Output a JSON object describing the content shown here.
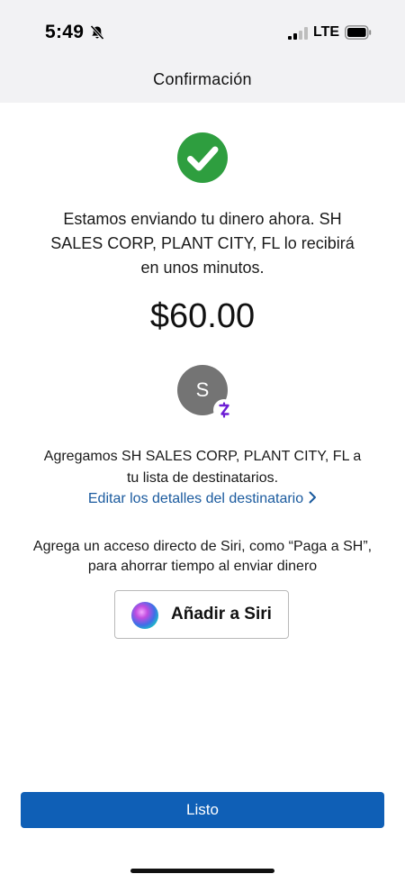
{
  "status_bar": {
    "time": "5:49",
    "network": "LTE",
    "icons": [
      "bell-slash-icon",
      "signal-icon",
      "battery-icon"
    ]
  },
  "header": {
    "title": "Confirmación"
  },
  "confirmation": {
    "message": "Estamos enviando tu dinero ahora. SH SALES CORP, PLANT CITY, FL lo recibirá en unos minutos.",
    "amount": "$60.00",
    "icon": "check-circle-icon",
    "accent_color": "#2e9e3f"
  },
  "recipient": {
    "avatar_initial": "S",
    "avatar_color": "#747474",
    "badge_icon": "zelle-icon",
    "badge_color": "#6d1ed4",
    "note": "Agregamos SH SALES CORP, PLANT CITY, FL a tu lista de destinatarios.",
    "edit_link": "Editar los detalles del destinatario",
    "link_color": "#1a5a9e"
  },
  "siri": {
    "note": "Agrega un acceso directo de Siri, como “Paga a SH”, para ahorrar tiempo al enviar dinero",
    "button_label": "Añadir a Siri",
    "icon": "siri-orb-icon"
  },
  "footer": {
    "done_label": "Listo",
    "button_color": "#0f5fb6"
  }
}
